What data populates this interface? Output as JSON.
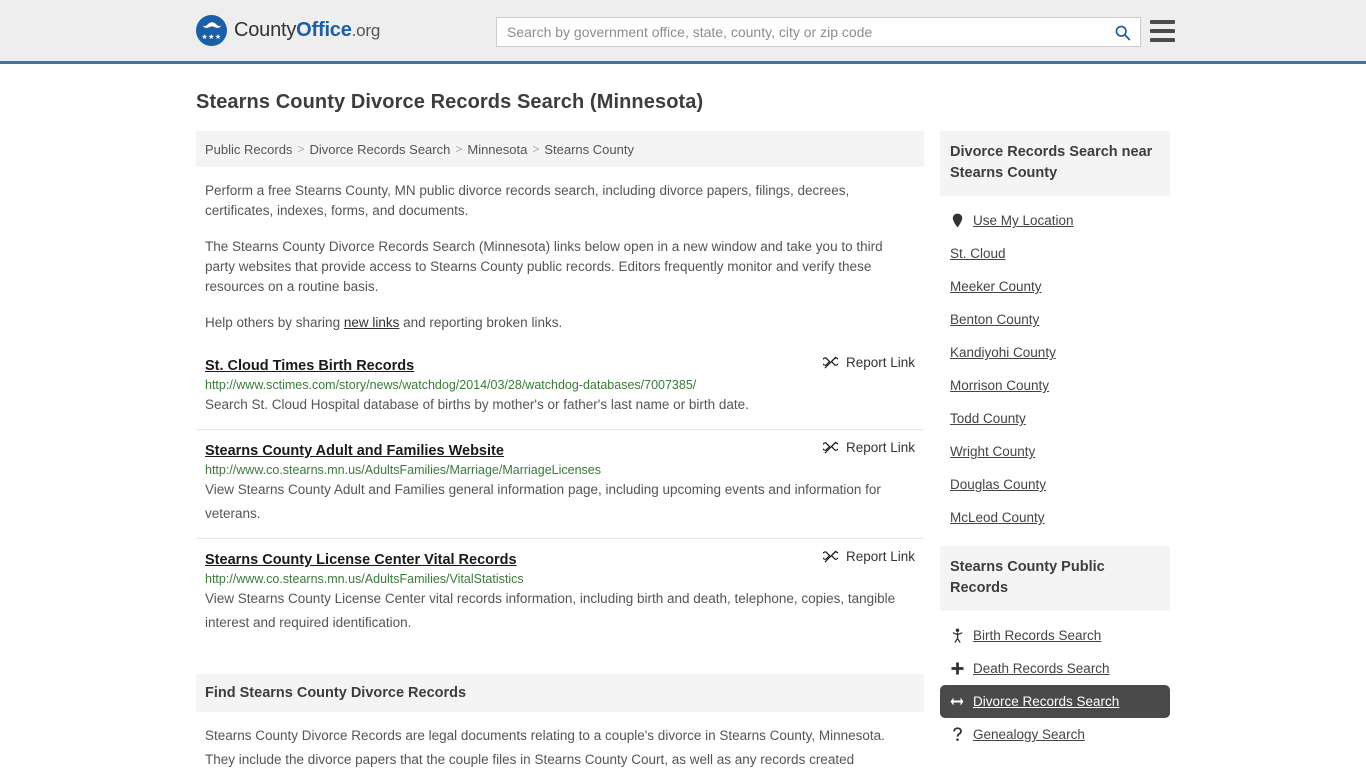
{
  "header": {
    "brand": {
      "part1": "County",
      "part2": "Office",
      "suffix": ".org"
    },
    "search": {
      "placeholder": "Search by government office, state, county, city or zip code",
      "value": "",
      "icon": "search-icon"
    },
    "menu_icon": "hamburger-menu-icon",
    "accent_color": "#3a74a8"
  },
  "page": {
    "title": "Stearns County Divorce Records Search (Minnesota)"
  },
  "breadcrumb": {
    "items": [
      {
        "label": "Public Records"
      },
      {
        "label": "Divorce Records Search"
      },
      {
        "label": "Minnesota"
      },
      {
        "label": "Stearns County"
      }
    ],
    "separator": ">"
  },
  "intro": {
    "p1": "Perform a free Stearns County, MN public divorce records search, including divorce papers, filings, decrees, certificates, indexes, forms, and documents.",
    "p2": "The Stearns County Divorce Records Search (Minnesota) links below open in a new window and take you to third party websites that provide access to Stearns County public records. Editors frequently monitor and verify these resources on a routine basis.",
    "p3_before": "Help others by sharing ",
    "p3_link": "new links",
    "p3_after": " and reporting broken links."
  },
  "results": {
    "report_label": "Report Link",
    "report_icon": "broken-link-icon",
    "items": [
      {
        "title": "St. Cloud Times Birth Records",
        "url": "http://www.sctimes.com/story/news/watchdog/2014/03/28/watchdog-databases/7007385/",
        "description": "Search St. Cloud Hospital database of births by mother's or father's last name or birth date."
      },
      {
        "title": "Stearns County Adult and Families Website",
        "url": "http://www.co.stearns.mn.us/AdultsFamilies/Marriage/MarriageLicenses",
        "description": "View Stearns County Adult and Families general information page, including upcoming events and information for veterans."
      },
      {
        "title": "Stearns County License Center Vital Records",
        "url": "http://www.co.stearns.mn.us/AdultsFamilies/VitalStatistics",
        "description": "View Stearns County License Center vital records information, including birth and death, telephone, copies, tangible interest and required identification."
      }
    ]
  },
  "find_section": {
    "header": "Find Stearns County Divorce Records",
    "body": "Stearns County Divorce Records are legal documents relating to a couple's divorce in Stearns County, Minnesota. They include the divorce papers that the couple files in Stearns County Court, as well as any records created"
  },
  "sidebar": {
    "nearby": {
      "header": "Divorce Records Search near Stearns County",
      "items": [
        {
          "label": "Use My Location",
          "icon": "map-pin-icon"
        },
        {
          "label": "St. Cloud",
          "icon": ""
        },
        {
          "label": "Meeker County",
          "icon": ""
        },
        {
          "label": "Benton County",
          "icon": ""
        },
        {
          "label": "Kandiyohi County",
          "icon": ""
        },
        {
          "label": "Morrison County",
          "icon": ""
        },
        {
          "label": "Todd County",
          "icon": ""
        },
        {
          "label": "Wright County",
          "icon": ""
        },
        {
          "label": "Douglas County",
          "icon": ""
        },
        {
          "label": "McLeod County",
          "icon": ""
        }
      ]
    },
    "public_records": {
      "header": "Stearns County Public Records",
      "active_item": "Divorce Records Search",
      "items": [
        {
          "label": "Birth Records Search",
          "icon": "baby-icon",
          "glyph": "♀",
          "active": false
        },
        {
          "label": "Death Records Search",
          "icon": "cross-icon",
          "glyph": "✚",
          "active": false
        },
        {
          "label": "Divorce Records Search",
          "icon": "left-right-arrow-icon",
          "glyph": "↔",
          "active": true
        },
        {
          "label": "Genealogy Search",
          "icon": "question-mark-icon",
          "glyph": "?",
          "active": false
        }
      ]
    }
  }
}
